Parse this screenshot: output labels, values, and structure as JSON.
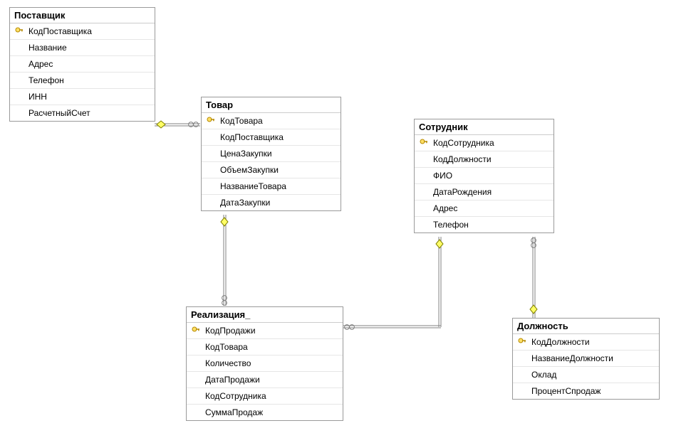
{
  "tables": {
    "supplier": {
      "title": "Поставщик",
      "fields": [
        {
          "name": "КодПоставщика",
          "pk": true
        },
        {
          "name": "Название",
          "pk": false
        },
        {
          "name": "Адрес",
          "pk": false
        },
        {
          "name": "Телефон",
          "pk": false
        },
        {
          "name": "ИНН",
          "pk": false
        },
        {
          "name": "РасчетныйСчет",
          "pk": false
        }
      ]
    },
    "product": {
      "title": "Товар",
      "fields": [
        {
          "name": "КодТовара",
          "pk": true
        },
        {
          "name": "КодПоставщика",
          "pk": false
        },
        {
          "name": "ЦенаЗакупки",
          "pk": false
        },
        {
          "name": "ОбъемЗакупки",
          "pk": false
        },
        {
          "name": "НазваниеТовара",
          "pk": false
        },
        {
          "name": "ДатаЗакупки",
          "pk": false
        }
      ]
    },
    "employee": {
      "title": "Сотрудник",
      "fields": [
        {
          "name": "КодСотрудника",
          "pk": true
        },
        {
          "name": "КодДолжности",
          "pk": false
        },
        {
          "name": "ФИО",
          "pk": false
        },
        {
          "name": "ДатаРождения",
          "pk": false
        },
        {
          "name": "Адрес",
          "pk": false
        },
        {
          "name": "Телефон",
          "pk": false
        }
      ]
    },
    "realization": {
      "title": "Реализация_",
      "fields": [
        {
          "name": "КодПродажи",
          "pk": true
        },
        {
          "name": "КодТовара",
          "pk": false
        },
        {
          "name": "Количество",
          "pk": false
        },
        {
          "name": "ДатаПродажи",
          "pk": false
        },
        {
          "name": "КодСотрудника",
          "pk": false
        },
        {
          "name": "СуммаПродаж",
          "pk": false
        }
      ]
    },
    "position": {
      "title": "Должность",
      "fields": [
        {
          "name": "КодДолжности",
          "pk": true
        },
        {
          "name": "НазваниеДолжности",
          "pk": false
        },
        {
          "name": "Оклад",
          "pk": false
        },
        {
          "name": "ПроцентСпродаж",
          "pk": false
        }
      ]
    }
  },
  "relationships": [
    {
      "from": "supplier",
      "to": "product",
      "type": "one-to-many"
    },
    {
      "from": "product",
      "to": "realization",
      "type": "one-to-many"
    },
    {
      "from": "employee",
      "to": "realization",
      "type": "one-to-many"
    },
    {
      "from": "position",
      "to": "employee",
      "type": "one-to-many"
    }
  ]
}
